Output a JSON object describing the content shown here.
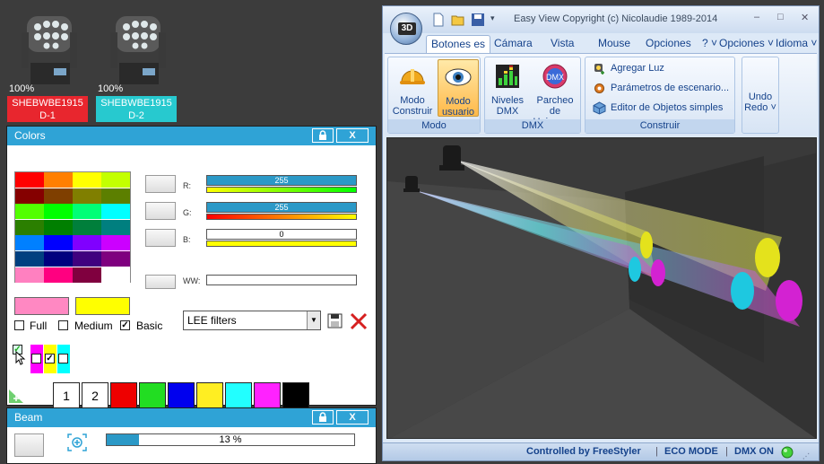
{
  "fixtures": [
    {
      "percent": "100%",
      "name": "SHEBWBE1915",
      "id": "D-1",
      "color": "#e8262e"
    },
    {
      "percent": "100%",
      "name": "SHEBWBE1915",
      "id": "D-2",
      "color": "#27c9cf"
    }
  ],
  "colors_panel": {
    "title": "Colors",
    "lock_symbol": "🔒",
    "close_label": "X",
    "swatches": [
      "#ff0000",
      "#ff7f00",
      "#ffff00",
      "#c3ff00",
      "#850000",
      "#7f3f00",
      "#807f00",
      "#5c7f00",
      "#52ff00",
      "#00ff00",
      "#00ff76",
      "#00ffff",
      "#2b7f00",
      "#007f00",
      "#007f3b",
      "#007f7f",
      "#0080ff",
      "#0000ff",
      "#8000ff",
      "#cc00ff",
      "#004080",
      "#00007f",
      "#40007f",
      "#7f007f",
      "#ff80c0",
      "#ff0080",
      "#80003f",
      "#ffffff"
    ],
    "channels": [
      {
        "label": "R:",
        "value": "255"
      },
      {
        "label": "G:",
        "value": "255"
      },
      {
        "label": "B:",
        "value": "0"
      },
      {
        "label": "WW:",
        "value": ""
      }
    ],
    "current_color_a": "#ff88c2",
    "current_color_b": "#ffff00",
    "mode_options": [
      {
        "label": "Full",
        "checked": false
      },
      {
        "label": "Medium",
        "checked": false
      },
      {
        "label": "Basic",
        "checked": true
      }
    ],
    "filter_select": "LEE filters",
    "presets": [
      "1",
      "2"
    ],
    "preset_colors": [
      "#ee0000",
      "#22dd22",
      "#0000ee",
      "#ffee22",
      "#22ffff",
      "#ff22ff",
      "#000000"
    ]
  },
  "beam_panel": {
    "title": "Beam",
    "close_label": "X",
    "progress_label": "13 %",
    "progress_value": 0.13
  },
  "window": {
    "title": "Easy View   Copyright (c) Nicolaudie 1989-2014",
    "orb_label": "3D",
    "controls": [
      "–",
      "□",
      "✕"
    ],
    "tabs": [
      {
        "label": "Botones es",
        "active": true
      },
      {
        "label": "Cámara"
      },
      {
        "label": "Vista"
      },
      {
        "label": "Mouse"
      },
      {
        "label": "Opciones d"
      },
      {
        "label": "? ˅"
      },
      {
        "label": "Opciones ˅"
      },
      {
        "label": "Idioma ˅"
      }
    ],
    "ribbon": {
      "modo_group": "Modo",
      "modo_construir": "Modo Construir",
      "modo_usuario": "Modo usuario",
      "dmx_group": "DMX",
      "niveles": "Niveles DMX",
      "parcheo": "Parcheo de Universos",
      "construir_group": "Construir",
      "agregar": "Agregar Luz",
      "parametros": "Parámetros de escenario...",
      "editor": "Editor de Objetos simples",
      "undo": "Undo",
      "redo": "Redo ˅"
    },
    "status": {
      "controlled": "Controlled by FreeStyler",
      "eco": "ECO MODE",
      "dmx": "DMX ON"
    }
  }
}
